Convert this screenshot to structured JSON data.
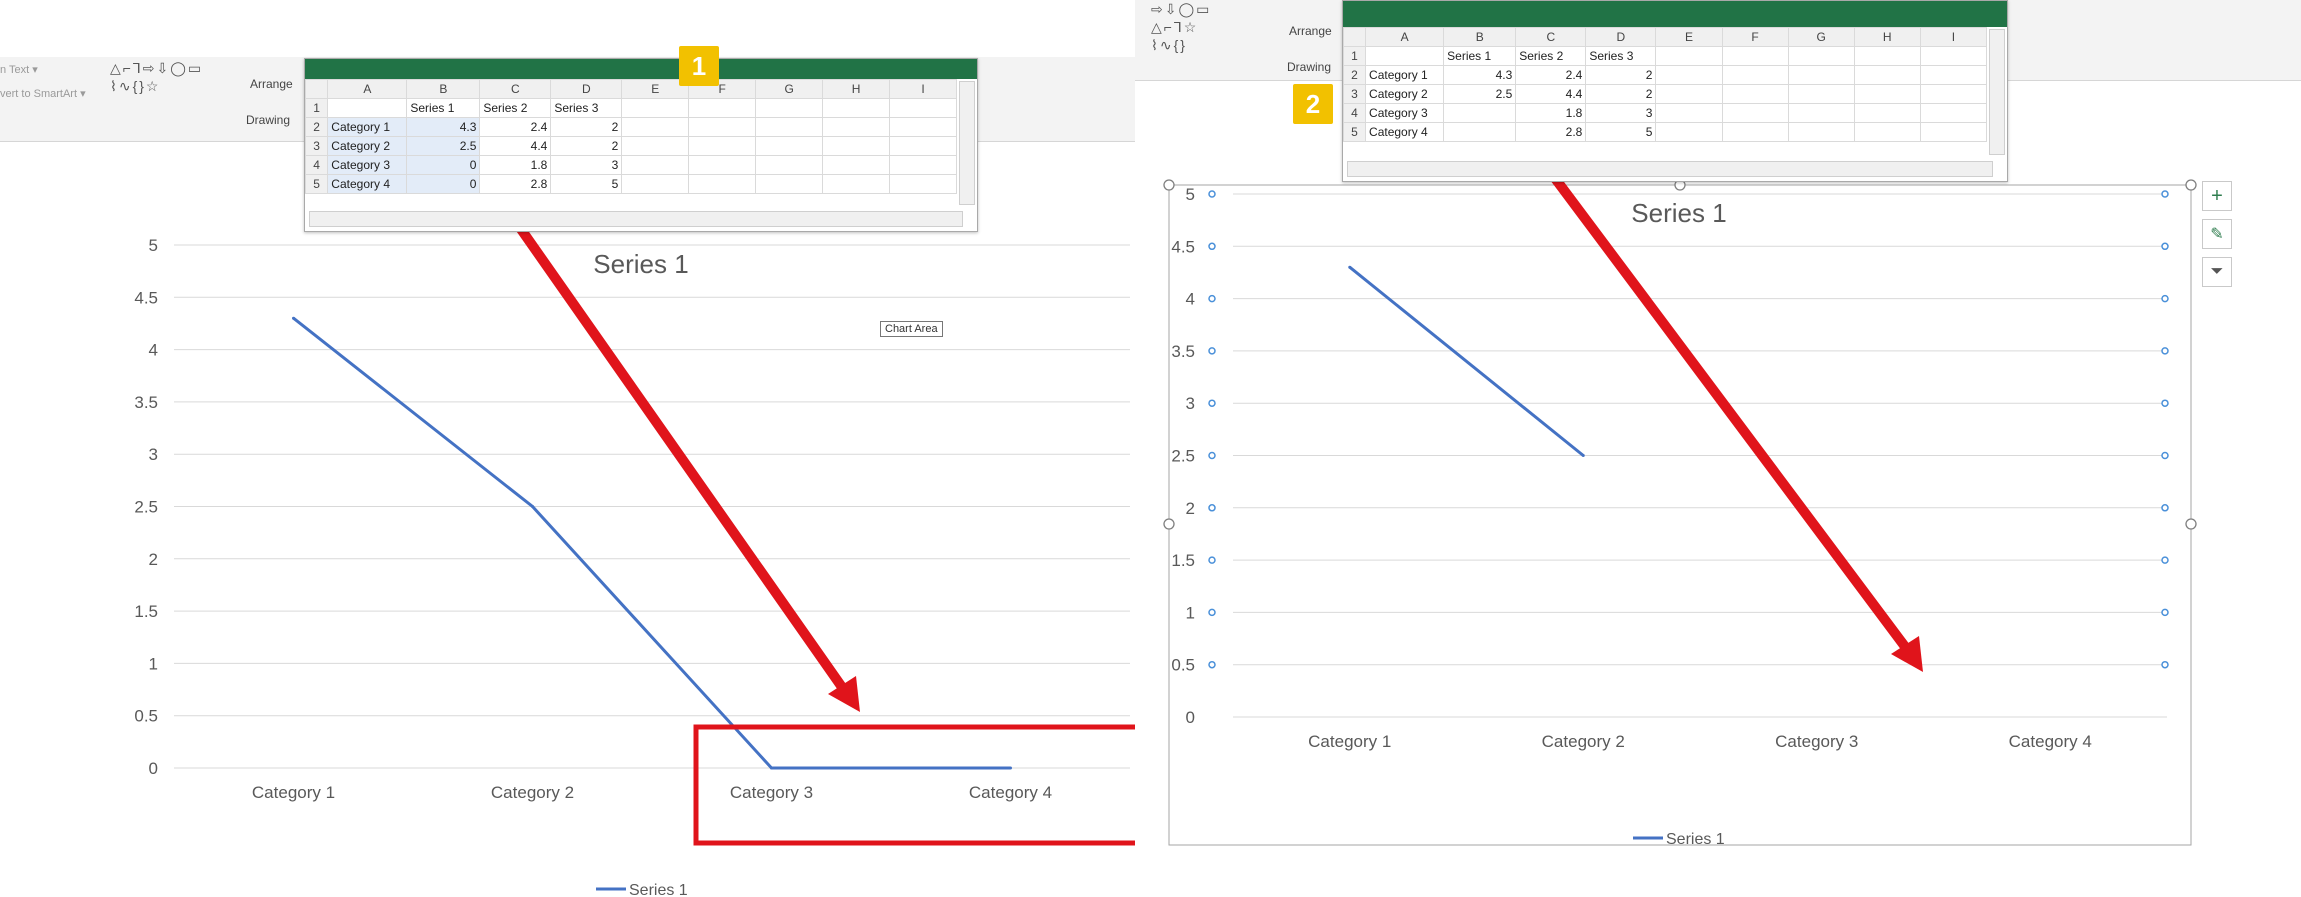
{
  "left": {
    "ribbon": {
      "ghost_text_1": "n Text ▾",
      "ghost_text_2": "vert to SmartArt ▾",
      "arrange_label": "Arrange",
      "drawing_label": "Drawing"
    },
    "badge": "1",
    "sheet": {
      "columns": [
        "",
        "A",
        "B",
        "C",
        "D",
        "E",
        "F",
        "G",
        "H",
        "I"
      ],
      "rows": [
        [
          "1",
          "",
          "Series 1",
          "Series 2",
          "Series 3",
          "",
          "",
          "",
          "",
          ""
        ],
        [
          "2",
          "Category 1",
          "4.3",
          "2.4",
          "2",
          "",
          "",
          "",
          "",
          ""
        ],
        [
          "3",
          "Category 2",
          "2.5",
          "4.4",
          "2",
          "",
          "",
          "",
          "",
          ""
        ],
        [
          "4",
          "Category 3",
          "0",
          "1.8",
          "3",
          "",
          "",
          "",
          "",
          ""
        ],
        [
          "5",
          "Category 4",
          "0",
          "2.8",
          "5",
          "",
          "",
          "",
          "",
          ""
        ]
      ]
    },
    "tooltip": "Chart Area",
    "legend": "Series 1"
  },
  "right": {
    "ribbon": {
      "arrange_label": "Arrange",
      "drawing_label": "Drawing"
    },
    "badge": "2",
    "sheet": {
      "columns": [
        "",
        "A",
        "B",
        "C",
        "D",
        "E",
        "F",
        "G",
        "H",
        "I"
      ],
      "rows": [
        [
          "1",
          "",
          "Series 1",
          "Series 2",
          "Series 3",
          "",
          "",
          "",
          "",
          ""
        ],
        [
          "2",
          "Category 1",
          "4.3",
          "2.4",
          "2",
          "",
          "",
          "",
          "",
          ""
        ],
        [
          "3",
          "Category 2",
          "2.5",
          "4.4",
          "2",
          "",
          "",
          "",
          "",
          ""
        ],
        [
          "4",
          "Category 3",
          "",
          "1.8",
          "3",
          "",
          "",
          "",
          "",
          ""
        ],
        [
          "5",
          "Category 4",
          "",
          "2.8",
          "5",
          "",
          "",
          "",
          "",
          ""
        ]
      ]
    },
    "legend": "Series 1"
  },
  "colors": {
    "series": "#4472c4",
    "highlight": "#e0141b",
    "ribbon": "#f3f3f3",
    "titlebar": "#217346",
    "badge": "#f2c100"
  },
  "chart_data": [
    {
      "type": "line",
      "title": "Series 1",
      "categories": [
        "Category 1",
        "Category 2",
        "Category 3",
        "Category 4"
      ],
      "series": [
        {
          "name": "Series 1",
          "values": [
            4.3,
            2.5,
            0,
            0
          ]
        }
      ],
      "y_ticks": [
        "0",
        "0.5",
        "1",
        "1.5",
        "2",
        "2.5",
        "3",
        "3.5",
        "4",
        "4.5",
        "5"
      ],
      "ylim": [
        0,
        5
      ],
      "grid": true,
      "legend": "bottom"
    },
    {
      "type": "line",
      "title": "Series 1",
      "categories": [
        "Category 1",
        "Category 2",
        "Category 3",
        "Category 4"
      ],
      "series": [
        {
          "name": "Series 1",
          "values": [
            4.3,
            2.5,
            null,
            null
          ]
        }
      ],
      "y_ticks": [
        "0",
        "0.5",
        "1",
        "1.5",
        "2",
        "2.5",
        "3",
        "3.5",
        "4",
        "4.5",
        "5"
      ],
      "ylim": [
        0,
        5
      ],
      "grid": true,
      "legend": "bottom"
    }
  ]
}
